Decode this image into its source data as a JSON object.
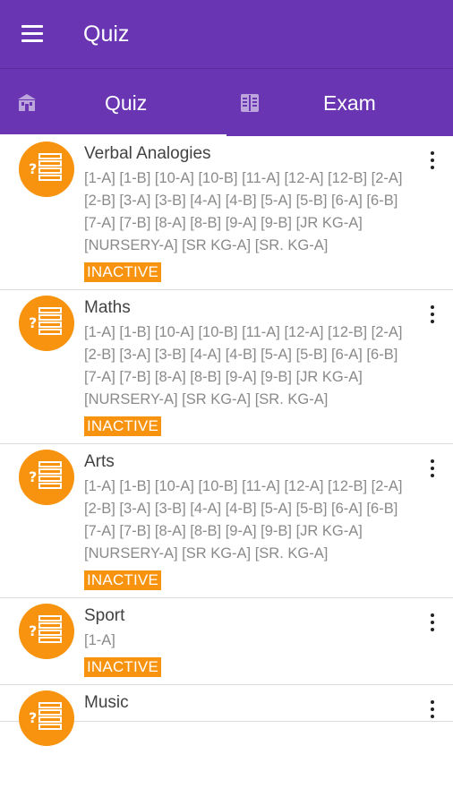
{
  "app_bar": {
    "title": "Quiz",
    "menu_icon": "hamburger-menu-icon"
  },
  "tabs": [
    {
      "label": "Quiz",
      "icon": "school-icon",
      "selected": true
    },
    {
      "label": "Exam",
      "icon": "exam-book-icon",
      "selected": false
    }
  ],
  "colors": {
    "primary": "#6a35b3",
    "accent": "#f7930e"
  },
  "quizzes": [
    {
      "title": "Verbal Analogies",
      "classes": "[1-A] [1-B] [10-A] [10-B] [11-A] [12-A] [12-B] [2-A] [2-B] [3-A] [3-B] [4-A] [4-B] [5-A] [5-B] [6-A] [6-B] [7-A] [7-B] [8-A] [8-B] [9-A] [9-B] [JR KG-A] [NURSERY-A] [SR KG-A] [SR. KG-A]",
      "status": "INACTIVE"
    },
    {
      "title": "Maths",
      "classes": "[1-A] [1-B] [10-A] [10-B] [11-A] [12-A] [12-B] [2-A] [2-B] [3-A] [3-B] [4-A] [4-B] [5-A] [5-B] [6-A] [6-B] [7-A] [7-B] [8-A] [8-B] [9-A] [9-B] [JR KG-A] [NURSERY-A] [SR KG-A] [SR. KG-A]",
      "status": "INACTIVE"
    },
    {
      "title": "Arts",
      "classes": "[1-A] [1-B] [10-A] [10-B] [11-A] [12-A] [12-B] [2-A] [2-B] [3-A] [3-B] [4-A] [4-B] [5-A] [5-B] [6-A] [6-B] [7-A] [7-B] [8-A] [8-B] [9-A] [9-B] [JR KG-A] [NURSERY-A] [SR KG-A] [SR. KG-A]",
      "status": "INACTIVE"
    },
    {
      "title": "Sport",
      "classes": "[1-A]",
      "status": "INACTIVE"
    },
    {
      "title": "Music",
      "classes": "",
      "status": ""
    }
  ]
}
